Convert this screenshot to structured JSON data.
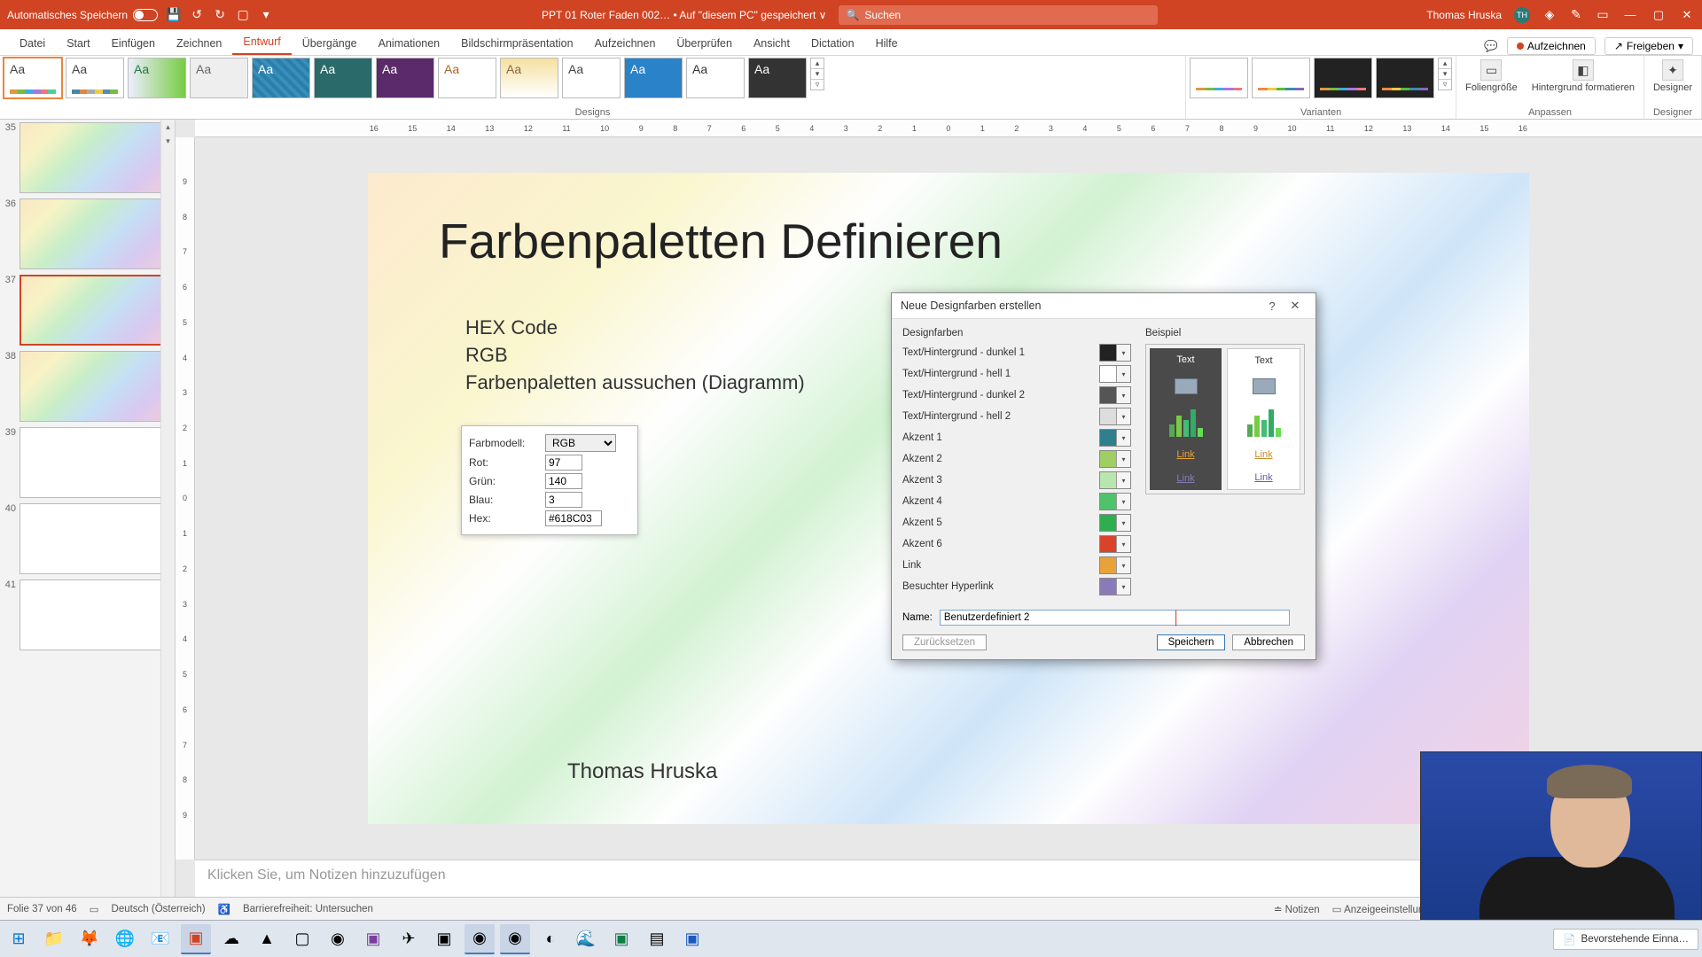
{
  "titlebar": {
    "autosave_label": "Automatisches Speichern",
    "doc_name": "PPT 01 Roter Faden 002…",
    "saved_loc": "• Auf \"diesem PC\" gespeichert",
    "search_placeholder": "Suchen",
    "user_name": "Thomas Hruska",
    "user_initials": "TH"
  },
  "ribbon": {
    "tabs": [
      "Datei",
      "Start",
      "Einfügen",
      "Zeichnen",
      "Entwurf",
      "Übergänge",
      "Animationen",
      "Bildschirmpräsentation",
      "Aufzeichnen",
      "Überprüfen",
      "Ansicht",
      "Dictation",
      "Hilfe"
    ],
    "active_tab_index": 4,
    "record_label": "Aufzeichnen",
    "share_label": "Freigeben",
    "groups": {
      "designs": "Designs",
      "variants": "Varianten",
      "customize": "Anpassen",
      "designer": "Designer"
    },
    "customize_btns": {
      "size": "Foliengröße",
      "bg": "Hintergrund formatieren",
      "designer": "Designer"
    }
  },
  "ruler": {
    "h": [
      "16",
      "15",
      "14",
      "13",
      "12",
      "11",
      "10",
      "9",
      "8",
      "7",
      "6",
      "5",
      "4",
      "3",
      "2",
      "1",
      "0",
      "1",
      "2",
      "3",
      "4",
      "5",
      "6",
      "7",
      "8",
      "9",
      "10",
      "11",
      "12",
      "13",
      "14",
      "15",
      "16"
    ],
    "v": [
      "9",
      "8",
      "7",
      "6",
      "5",
      "4",
      "3",
      "2",
      "1",
      "0",
      "1",
      "2",
      "3",
      "4",
      "5",
      "6",
      "7",
      "8",
      "9"
    ]
  },
  "thumbs": {
    "numbers": [
      "35",
      "36",
      "37",
      "38",
      "39",
      "40",
      "41"
    ],
    "active_index": 2
  },
  "slide": {
    "title": "Farbenpaletten Definieren",
    "bullets": [
      "HEX Code",
      "RGB",
      "Farbenpaletten aussuchen (Diagramm)"
    ],
    "author": "Thomas Hruska",
    "color_box": {
      "model_label": "Farbmodell:",
      "model_value": "RGB",
      "rot_label": "Rot:",
      "rot_value": "97",
      "gruen_label": "Grün:",
      "gruen_value": "140",
      "blau_label": "Blau:",
      "blau_value": "3",
      "hex_label": "Hex:",
      "hex_value": "#618C03"
    }
  },
  "dialog": {
    "title": "Neue Designfarben erstellen",
    "left_header": "Designfarben",
    "right_header": "Beispiel",
    "rows": [
      {
        "label": "Text/Hintergrund - dunkel 1",
        "color": "#222222"
      },
      {
        "label": "Text/Hintergrund - hell 1",
        "color": "#ffffff"
      },
      {
        "label": "Text/Hintergrund - dunkel 2",
        "color": "#555555"
      },
      {
        "label": "Text/Hintergrund - hell 2",
        "color": "#dddddd"
      },
      {
        "label": "Akzent 1",
        "color": "#2f7f8f"
      },
      {
        "label": "Akzent 2",
        "color": "#9fce63"
      },
      {
        "label": "Akzent 3",
        "color": "#b9e6b0"
      },
      {
        "label": "Akzent 4",
        "color": "#4fc26b"
      },
      {
        "label": "Akzent 5",
        "color": "#2fae4f"
      },
      {
        "label": "Akzent 6",
        "color": "#d9432a"
      },
      {
        "label": "Link",
        "color": "#e8a23a"
      },
      {
        "label": "Besuchter Hyperlink",
        "color": "#8a7bb8"
      }
    ],
    "preview_text": "Text",
    "preview_link": "Link",
    "name_label": "Name:",
    "name_value": "Benutzerdefiniert 2",
    "btn_reset": "Zurücksetzen",
    "btn_save": "Speichern",
    "btn_cancel": "Abbrechen"
  },
  "notes_placeholder": "Klicken Sie, um Notizen hinzuzufügen",
  "statusbar": {
    "slide": "Folie 37 von 46",
    "lang": "Deutsch (Österreich)",
    "access": "Barrierefreiheit: Untersuchen",
    "notes": "Notizen",
    "display": "Anzeigeeinstellungen"
  },
  "taskbar": {
    "pill": "Bevorstehende Einna…"
  }
}
